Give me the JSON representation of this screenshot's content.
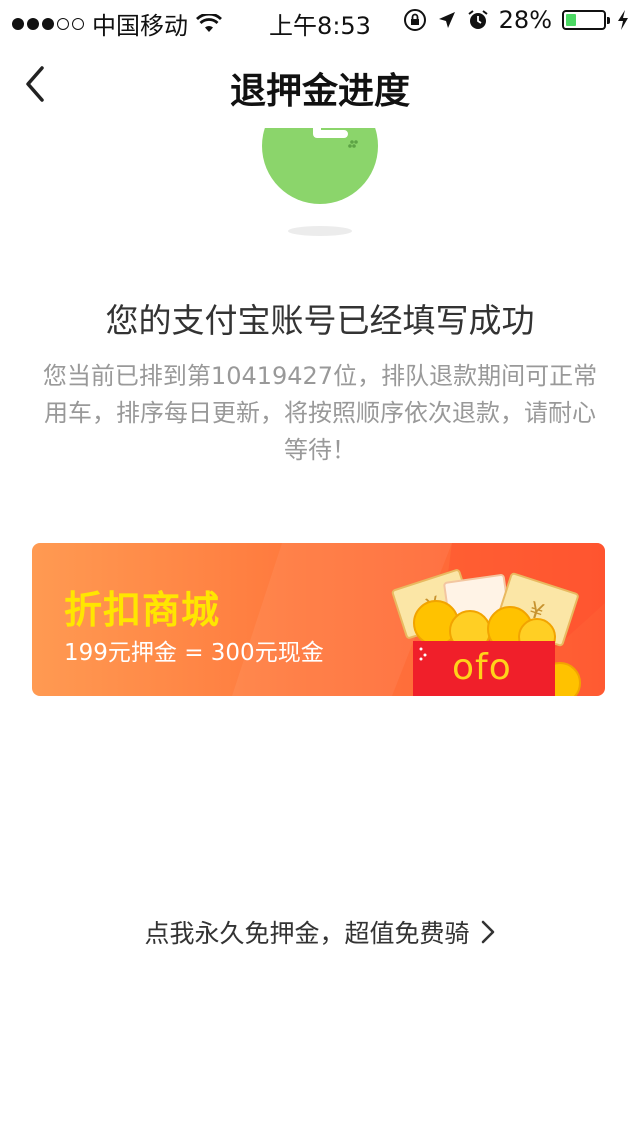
{
  "status_bar": {
    "carrier": "中国移动",
    "time": "上午8:53",
    "battery_text": "28%",
    "battery_level": 0.28,
    "battery_color": "#4cd964"
  },
  "nav": {
    "title": "退押金进度",
    "back_icon": "chevron-left-icon"
  },
  "main": {
    "illustration_icon": "clock-icon",
    "success_title": "您的支付宝账号已经填写成功",
    "queue_text": "您当前已排到第10419427位，排队退款期间可正常用车，排序每日更新，将按照顺序依次退款，请耐心等待！"
  },
  "promo": {
    "title": "折扣商城",
    "subtitle": "199元押金 = 300元现金",
    "logo_text": "ofo",
    "title_color": "#ffe600"
  },
  "footer_link": {
    "label": "点我永久免押金，超值免费骑",
    "icon": "chevron-right-icon"
  }
}
